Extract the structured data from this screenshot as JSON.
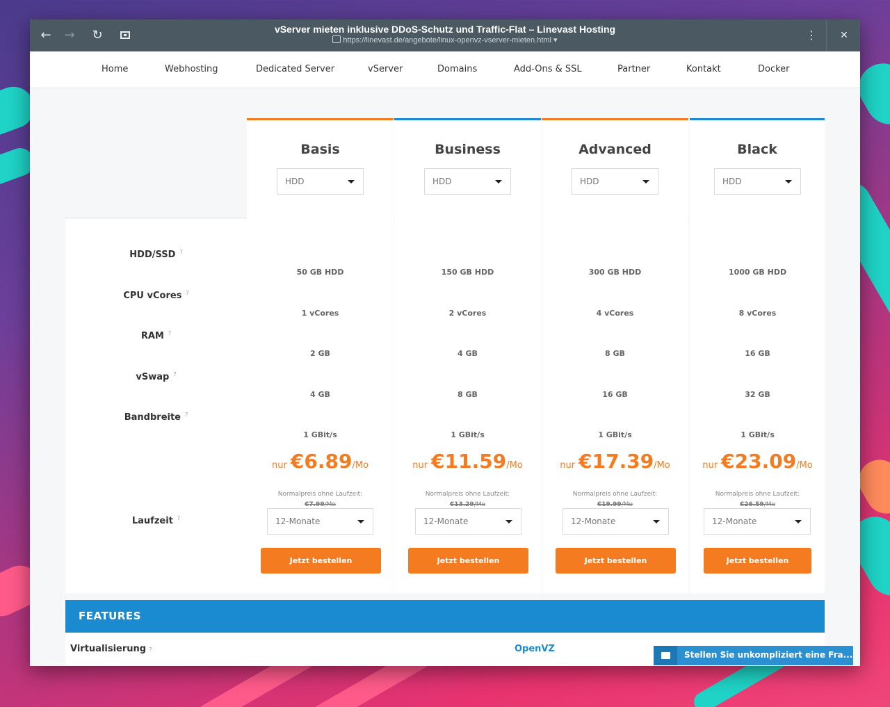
{
  "window": {
    "title": "vServer mieten inklusive DDoS-Schutz und Traffic-Flat – Linevast Hosting",
    "url": "https://linevast.de/angebote/linux-openvz-vserver-mieten.html ▾"
  },
  "nav": [
    "Home",
    "Webhosting",
    "Dedicated Server",
    "vServer",
    "Domains",
    "Add-Ons & SSL",
    "Partner",
    "Kontakt",
    "Docker"
  ],
  "colors": {
    "accent": "#f47b20",
    "blue": "#1a8bd0",
    "titlebar": "#4b5a62"
  },
  "row_labels": {
    "hdd": "HDD/SSD",
    "cpu": "CPU vCores",
    "ram": "RAM",
    "vswap": "vSwap",
    "bandwidth": "Bandbreite",
    "laufzeit": "Laufzeit",
    "help": "?"
  },
  "plans": [
    {
      "name": "Basis",
      "disk_select": "HDD",
      "hdd": "50 GB HDD",
      "cpu": "1 vCores",
      "ram": "2 GB",
      "vswap": "4 GB",
      "bandwidth": "1 GBit/s",
      "price_prefix": "nur",
      "price": "€6.89",
      "price_suffix": "/Mo",
      "normal_label": "Normalpreis ohne Laufzeit:",
      "normal_price": "€7.99",
      "normal_suffix": "/Mo",
      "term": "12-Monate",
      "order": "Jetzt bestellen",
      "bar_color": "#f47b20"
    },
    {
      "name": "Business",
      "disk_select": "HDD",
      "hdd": "150 GB HDD",
      "cpu": "2 vCores",
      "ram": "4 GB",
      "vswap": "8 GB",
      "bandwidth": "1 GBit/s",
      "price_prefix": "nur",
      "price": "€11.59",
      "price_suffix": "/Mo",
      "normal_label": "Normalpreis ohne Laufzeit:",
      "normal_price": "€13.29",
      "normal_suffix": "/Mo",
      "term": "12-Monate",
      "order": "Jetzt bestellen",
      "bar_color": "#1a8bd0"
    },
    {
      "name": "Advanced",
      "disk_select": "HDD",
      "hdd": "300 GB HDD",
      "cpu": "4 vCores",
      "ram": "8 GB",
      "vswap": "16 GB",
      "bandwidth": "1 GBit/s",
      "price_prefix": "nur",
      "price": "€17.39",
      "price_suffix": "/Mo",
      "normal_label": "Normalpreis ohne Laufzeit:",
      "normal_price": "€19.99",
      "normal_suffix": "/Mo",
      "term": "12-Monate",
      "order": "Jetzt bestellen",
      "bar_color": "#f47b20"
    },
    {
      "name": "Black",
      "disk_select": "HDD",
      "hdd": "1000 GB HDD",
      "cpu": "8 vCores",
      "ram": "16 GB",
      "vswap": "32 GB",
      "bandwidth": "1 GBit/s",
      "price_prefix": "nur",
      "price": "€23.09",
      "price_suffix": "/Mo",
      "normal_label": "Normalpreis ohne Laufzeit:",
      "normal_price": "€26.59",
      "normal_suffix": "/Mo",
      "term": "12-Monate",
      "order": "Jetzt bestellen",
      "bar_color": "#1a8bd0"
    }
  ],
  "features": {
    "title": "FEATURES",
    "virt_label": "Virtualisierung",
    "virt_value": "OpenVZ",
    "help": "?"
  },
  "chat": {
    "label": "Stellen Sie unkompliziert eine Fra..."
  }
}
